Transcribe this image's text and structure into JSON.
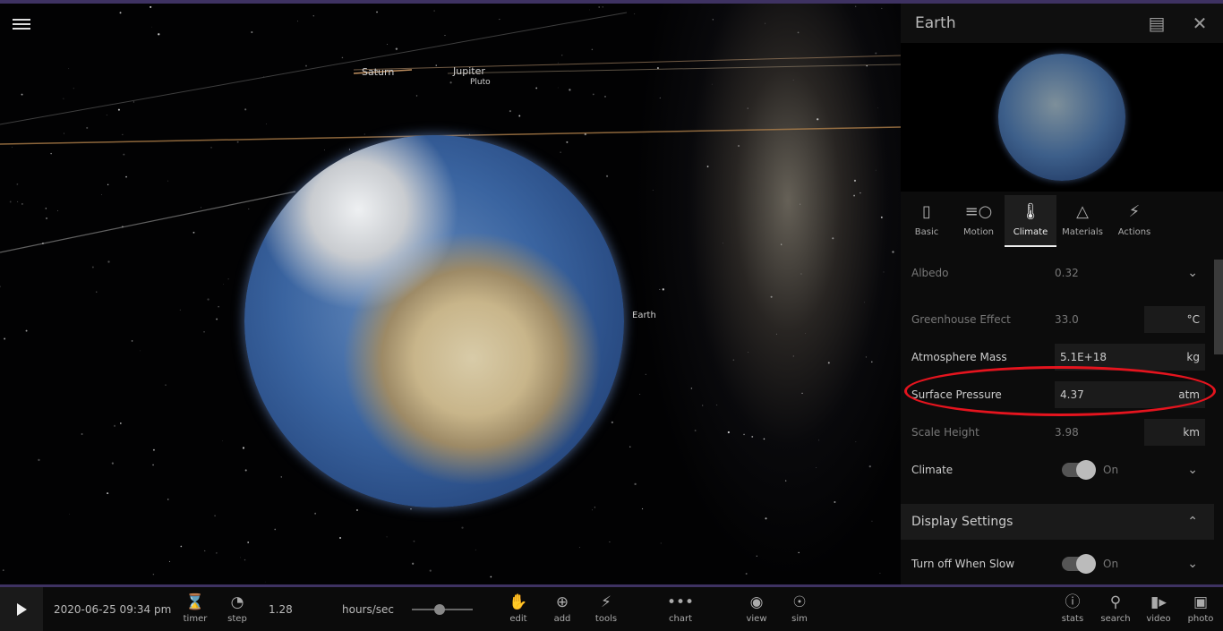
{
  "scene": {
    "labels": {
      "saturn": "Saturn",
      "jupiter": "Jupiter",
      "pluto": "Pluto",
      "earth": "Earth"
    },
    "menu_icon": "hamburger-icon"
  },
  "panel": {
    "title": "Earth",
    "icons": [
      "no-image-icon",
      "close-icon"
    ],
    "tabs": [
      {
        "label": "Basic",
        "icon": "bookmark-icon"
      },
      {
        "label": "Motion",
        "icon": "motion-icon"
      },
      {
        "label": "Climate",
        "icon": "thermometer-icon",
        "active": true
      },
      {
        "label": "Materials",
        "icon": "materials-icon"
      },
      {
        "label": "Actions",
        "icon": "lightning-icon"
      }
    ],
    "rows": {
      "albedo": {
        "label": "Albedo",
        "value": "0.32"
      },
      "greenhouse": {
        "label": "Greenhouse Effect",
        "value": "33.0",
        "unit": "°C"
      },
      "atm_mass": {
        "label": "Atmosphere Mass",
        "value": "5.1E+18",
        "unit": "kg"
      },
      "pressure": {
        "label": "Surface Pressure",
        "value": "4.37",
        "unit": "atm"
      },
      "scale": {
        "label": "Scale Height",
        "value": "3.98",
        "unit": "km"
      },
      "climate": {
        "label": "Climate",
        "state": "On"
      }
    },
    "display_settings": {
      "label": "Display Settings",
      "turn_off": {
        "label": "Turn off When Slow",
        "state": "On"
      }
    },
    "highlight_color": "#e5141e"
  },
  "toolbar": {
    "datetime": "2020-06-25 09:34 pm",
    "rate": "1.28",
    "rate_unit": "hours/sec",
    "speed_slider": 0.45,
    "buttons": {
      "timer": "timer",
      "step": "step",
      "edit": "edit",
      "add": "add",
      "tools": "tools",
      "chart": "chart",
      "view": "view",
      "sim": "sim",
      "stats": "stats",
      "search": "search",
      "video": "video",
      "photo": "photo"
    }
  },
  "colors": {
    "accent": "#3e3262"
  }
}
